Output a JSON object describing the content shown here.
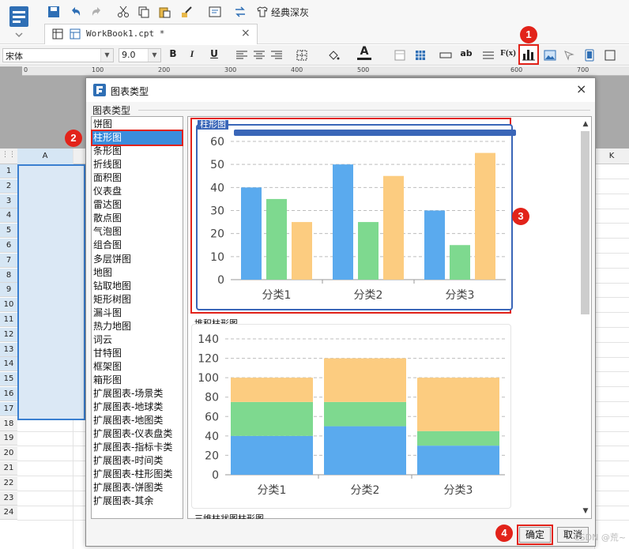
{
  "toolbar": {
    "theme_label": "经典深灰",
    "tab_label": "WorkBook1.cpt *",
    "tab_close": "×",
    "font_name": "宋体",
    "font_size": "9.0",
    "bold": "B",
    "italic": "I",
    "underline": "U",
    "text_ab": "ab",
    "formula": "F(x)",
    "font_color_letter": "A"
  },
  "ruler": {
    "ticks": [
      "0",
      "100",
      "200",
      "300",
      "400",
      "500",
      "600",
      "700"
    ]
  },
  "sheet": {
    "col_a": "A",
    "col_k": "K",
    "rows": [
      "1",
      "2",
      "3",
      "4",
      "5",
      "6",
      "7",
      "8",
      "9",
      "10",
      "11",
      "12",
      "13",
      "14",
      "15",
      "16",
      "17",
      "18",
      "19",
      "20",
      "21",
      "22",
      "23",
      "24"
    ]
  },
  "dialog": {
    "title": "图表类型",
    "close": "×",
    "group_label": "图表类型",
    "types": [
      "饼图",
      "柱形图",
      "条形图",
      "折线图",
      "面积图",
      "仪表盘",
      "雷达图",
      "散点图",
      "气泡图",
      "组合图",
      "多层饼图",
      "地图",
      "钻取地图",
      "矩形树图",
      "漏斗图",
      "热力地图",
      "词云",
      "甘特图",
      "框架图",
      "箱形图",
      "扩展图表-场景类",
      "扩展图表-地球类",
      "扩展图表-地图类",
      "扩展图表-仪表盘类",
      "扩展图表-指标卡类",
      "扩展图表-时间类",
      "扩展图表-柱形图类",
      "扩展图表-饼图类",
      "扩展图表-其余"
    ],
    "selected_index": 1,
    "ok": "确定",
    "cancel": "取消",
    "scroll_up": "▲",
    "scroll_down": "▼",
    "next_caption": "三维柱状图柱形图"
  },
  "badges": [
    "1",
    "2",
    "3",
    "4"
  ],
  "watermark": "CSDN @荒~",
  "colors": {
    "blue": "#5aaaee",
    "green": "#7ed98f",
    "orange": "#fccc80",
    "accent": "#e2231a",
    "frame": "#3a66b8"
  },
  "chart_data": [
    {
      "type": "bar",
      "title": "柱形图",
      "categories": [
        "分类1",
        "分类2",
        "分类3"
      ],
      "series": [
        {
          "values": [
            40,
            50,
            30
          ]
        },
        {
          "values": [
            35,
            25,
            15
          ]
        },
        {
          "values": [
            25,
            45,
            55
          ]
        }
      ],
      "ylim": [
        0,
        60
      ],
      "yticks": [
        0,
        10,
        20,
        30,
        40,
        50,
        60
      ],
      "grid": true
    },
    {
      "type": "bar",
      "stacked": true,
      "title": "堆积柱形图",
      "categories": [
        "分类1",
        "分类2",
        "分类3"
      ],
      "series": [
        {
          "values": [
            40,
            50,
            30
          ]
        },
        {
          "values": [
            35,
            25,
            15
          ]
        },
        {
          "values": [
            25,
            45,
            55
          ]
        }
      ],
      "ylim": [
        0,
        140
      ],
      "yticks": [
        0,
        20,
        40,
        60,
        80,
        100,
        120,
        140
      ],
      "grid": true
    }
  ]
}
